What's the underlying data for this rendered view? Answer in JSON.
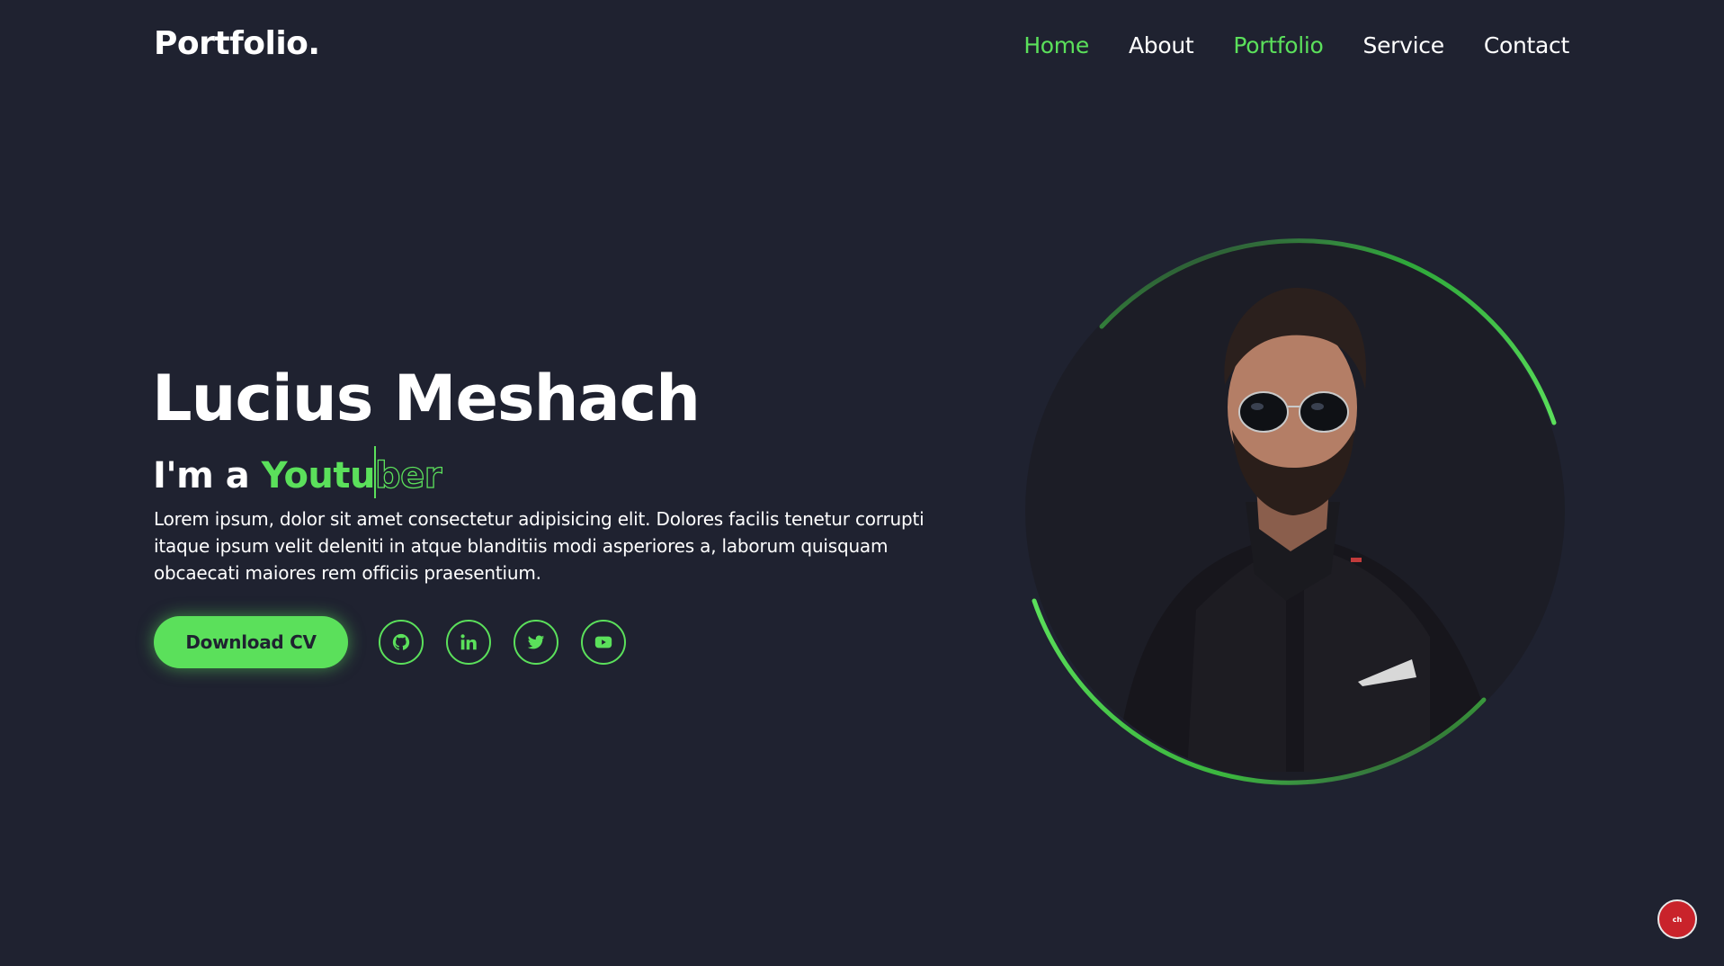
{
  "header": {
    "logo": "Portfolio.",
    "nav": [
      {
        "label": "Home",
        "active": true
      },
      {
        "label": "About",
        "active": false
      },
      {
        "label": "Portfolio",
        "active": true
      },
      {
        "label": "Service",
        "active": false
      },
      {
        "label": "Contact",
        "active": false
      }
    ]
  },
  "hero": {
    "name": "Lucius Meshach",
    "role_prefix": "I'm a ",
    "role_typed": "Youtu",
    "role_remaining": "ber",
    "description": "Lorem ipsum, dolor sit amet consectetur adipisicing elit. Dolores facilis tenetur corrupti itaque ipsum velit deleniti in atque blanditiis modi asperiores a, laborum quisquam obcaecati maiores rem officiis praesentium.",
    "cv_button": "Download CV",
    "socials": [
      "github-icon",
      "linkedin-icon",
      "twitter-icon",
      "youtube-icon"
    ]
  },
  "badge": {
    "label": "ch"
  },
  "colors": {
    "background": "#1f2230",
    "accent": "#5be05b",
    "text": "#ffffff"
  }
}
